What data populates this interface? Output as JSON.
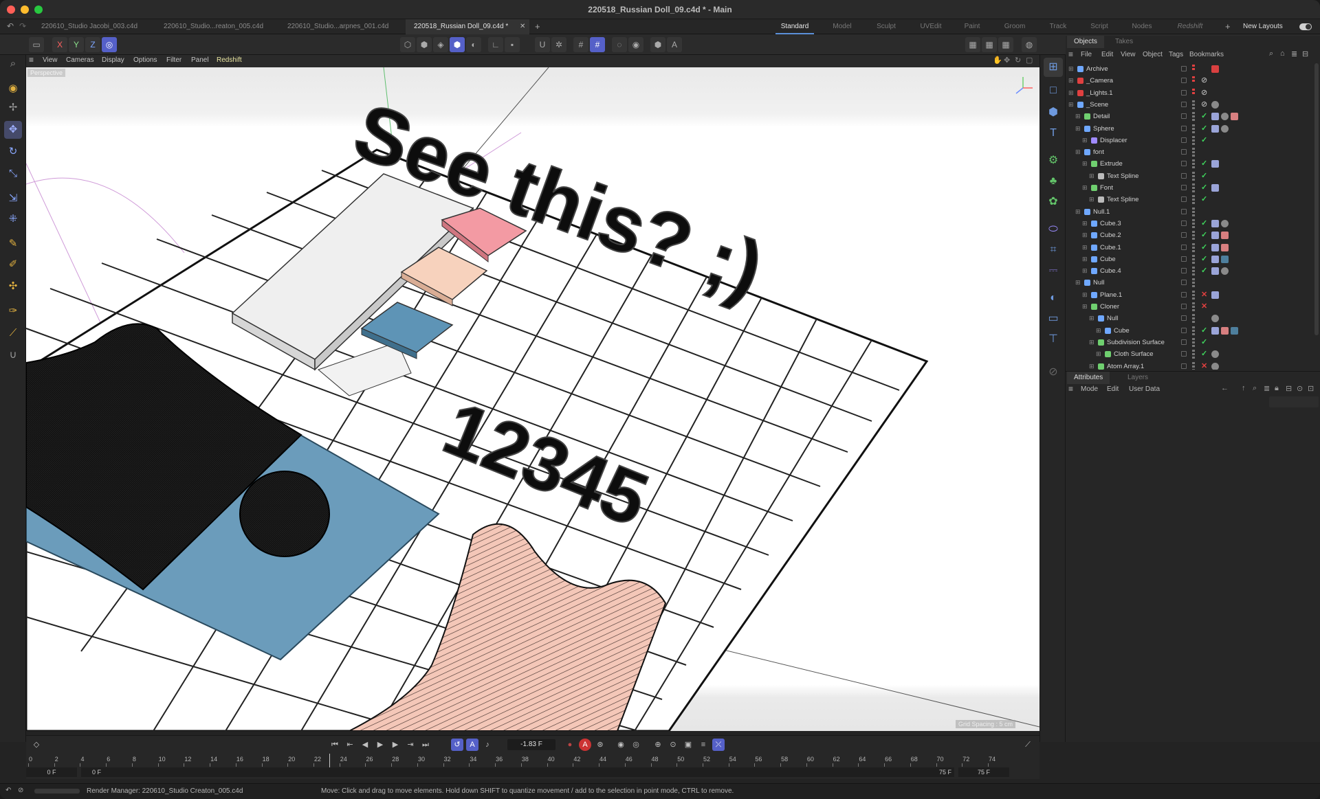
{
  "window": {
    "title": "220518_Russian Doll_09.c4d * - Main"
  },
  "doc_tabs": [
    {
      "label": "220610_Studio Jacobi_003.c4d",
      "active": false
    },
    {
      "label": "220610_Studio...reaton_005.c4d",
      "active": false
    },
    {
      "label": "220610_Studio...arpnes_001.c4d",
      "active": false
    },
    {
      "label": "220518_Russian Doll_09.c4d *",
      "active": true
    }
  ],
  "layouts": {
    "items": [
      {
        "label": "Standard",
        "active": true
      },
      {
        "label": "Model",
        "active": false
      },
      {
        "label": "Sculpt",
        "active": false
      },
      {
        "label": "UVEdit",
        "active": false
      },
      {
        "label": "Paint",
        "active": false
      },
      {
        "label": "Groom",
        "active": false
      },
      {
        "label": "Track",
        "active": false
      },
      {
        "label": "Script",
        "active": false
      },
      {
        "label": "Nodes",
        "active": false
      },
      {
        "label": "Redshift",
        "active": false
      }
    ],
    "new_layouts": "New Layouts"
  },
  "axis_buttons": [
    "X",
    "Y",
    "Z"
  ],
  "viewport_menu": [
    "View",
    "Cameras",
    "Display",
    "Options",
    "Filter",
    "Panel",
    "Redshift"
  ],
  "viewport": {
    "label": "Perspective",
    "grid_spacing": "Grid Spacing : 5 cm",
    "text_3d_a": "See this? ;)",
    "text_3d_b": "12345"
  },
  "panel_tabs": {
    "objects": "Objects",
    "takes": "Takes"
  },
  "objects_menu": [
    "File",
    "Edit",
    "View",
    "Object",
    "Tags",
    "Bookmarks"
  ],
  "objects": [
    {
      "name": "Archive",
      "depth": 0,
      "icon": "null",
      "status": "",
      "tags": [
        "pin"
      ]
    },
    {
      "name": "_Camera",
      "depth": 0,
      "icon": "camera",
      "status": "forbid",
      "tags": []
    },
    {
      "name": "_Lights.1",
      "depth": 0,
      "icon": "light",
      "status": "forbid",
      "tags": []
    },
    {
      "name": "_Scene",
      "depth": 0,
      "icon": "null",
      "status": "forbid",
      "tags": [
        "gray"
      ]
    },
    {
      "name": "Detail",
      "depth": 1,
      "icon": "spline",
      "status": "check",
      "tags": [
        "phong",
        "gray",
        "pink"
      ]
    },
    {
      "name": "Sphere",
      "depth": 1,
      "icon": "prim",
      "status": "check",
      "tags": [
        "phong",
        "gray"
      ]
    },
    {
      "name": "Displacer",
      "depth": 2,
      "icon": "deformer",
      "status": "check",
      "tags": []
    },
    {
      "name": "font",
      "depth": 1,
      "icon": "null",
      "status": "",
      "tags": []
    },
    {
      "name": "Extrude",
      "depth": 2,
      "icon": "generator",
      "status": "check",
      "tags": [
        "phong"
      ]
    },
    {
      "name": "Text Spline",
      "depth": 3,
      "icon": "text",
      "status": "check",
      "tags": []
    },
    {
      "name": "Font",
      "depth": 2,
      "icon": "generator",
      "status": "check",
      "tags": [
        "phong"
      ]
    },
    {
      "name": "Text Spline",
      "depth": 3,
      "icon": "text",
      "status": "check",
      "tags": []
    },
    {
      "name": "Null.1",
      "depth": 1,
      "icon": "null",
      "status": "",
      "tags": []
    },
    {
      "name": "Cube.3",
      "depth": 2,
      "icon": "prim",
      "status": "check",
      "tags": [
        "phong",
        "gray"
      ]
    },
    {
      "name": "Cube.2",
      "depth": 2,
      "icon": "prim",
      "status": "check",
      "tags": [
        "phong",
        "pink"
      ]
    },
    {
      "name": "Cube.1",
      "depth": 2,
      "icon": "prim",
      "status": "check",
      "tags": [
        "phong",
        "pink"
      ]
    },
    {
      "name": "Cube",
      "depth": 2,
      "icon": "prim",
      "status": "check",
      "tags": [
        "phong",
        "blue"
      ]
    },
    {
      "name": "Cube.4",
      "depth": 2,
      "icon": "prim",
      "status": "check",
      "tags": [
        "phong",
        "gray"
      ]
    },
    {
      "name": "Null",
      "depth": 1,
      "icon": "null",
      "status": "",
      "tags": []
    },
    {
      "name": "Plane.1",
      "depth": 2,
      "icon": "prim",
      "status": "cross",
      "tags": [
        "phong"
      ]
    },
    {
      "name": "Cloner",
      "depth": 2,
      "icon": "mograph",
      "status": "cross",
      "tags": []
    },
    {
      "name": "Null",
      "depth": 3,
      "icon": "null",
      "status": "",
      "tags": [
        "gray"
      ]
    },
    {
      "name": "Cube",
      "depth": 4,
      "icon": "prim",
      "status": "check",
      "tags": [
        "phong",
        "pink",
        "blue"
      ]
    },
    {
      "name": "Subdivision Surface",
      "depth": 3,
      "icon": "generator",
      "status": "check",
      "tags": []
    },
    {
      "name": "Cloth Surface",
      "depth": 4,
      "icon": "generator",
      "status": "check",
      "tags": [
        "gray"
      ]
    },
    {
      "name": "Atom Array.1",
      "depth": 3,
      "icon": "generator",
      "status": "cross",
      "tags": [
        "gray"
      ]
    }
  ],
  "attr_tabs": {
    "attributes": "Attributes",
    "layers": "Layers"
  },
  "attr_menu": [
    "Mode",
    "Edit",
    "User Data"
  ],
  "timeline": {
    "current_frame_field": "-1.83 F",
    "ticks": [
      "0",
      "2",
      "4",
      "6",
      "8",
      "10",
      "12",
      "14",
      "16",
      "18",
      "20",
      "22",
      "24",
      "26",
      "28",
      "30",
      "32",
      "34",
      "36",
      "38",
      "40",
      "42",
      "44",
      "46",
      "48",
      "50",
      "52",
      "54",
      "56",
      "58",
      "60",
      "62",
      "64",
      "66",
      "68",
      "70",
      "72",
      "74"
    ],
    "min_start": "0 F",
    "preview_start": "0 F",
    "preview_end": "75 F",
    "max_end": "75 F"
  },
  "status_bar": {
    "render_manager": "Render Manager: 220610_Studio Creaton_005.c4d",
    "hint": "Move: Click and drag to move elements. Hold down SHIFT to quantize movement / add to the selection in point mode, CTRL to remove."
  },
  "colors": {
    "accent": "#5560c8",
    "check": "#3fd35c",
    "cross": "#e04040",
    "cube_pink": "#f39aa3",
    "cube_peach": "#f7d2bd",
    "cube_blue": "#5e94b6",
    "cloth_pink": "#f2c2b2"
  }
}
